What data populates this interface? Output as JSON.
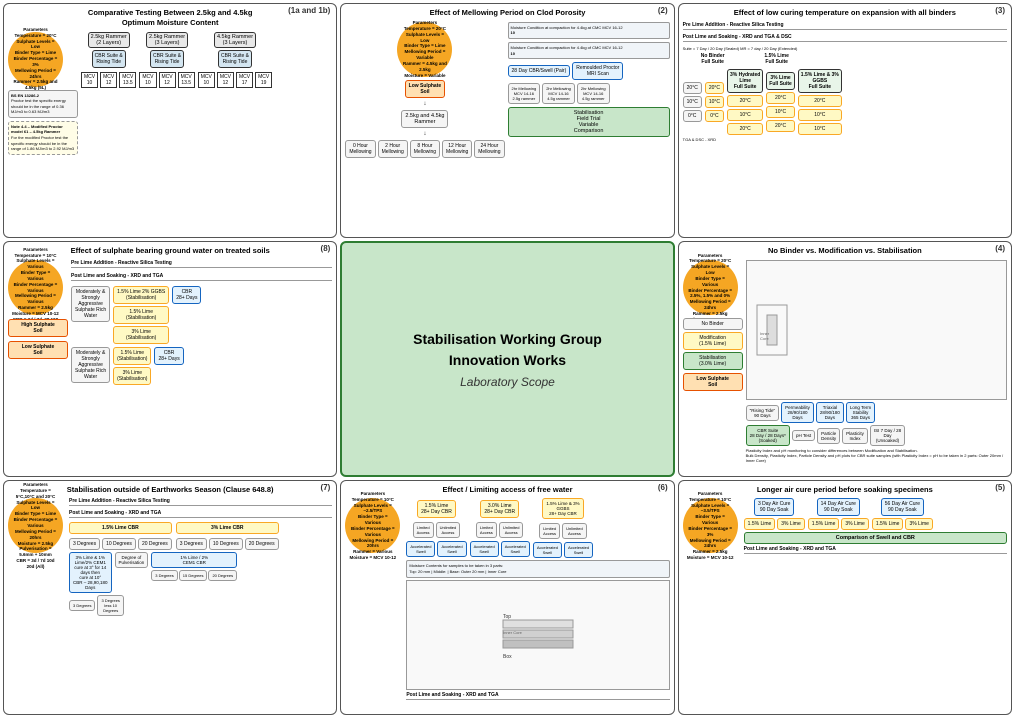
{
  "panels": {
    "panel1": {
      "number": "(1a and 1b)",
      "title": "Comparative Testing Between 2.5kg and 4.5kg",
      "subtitle": "Optimum Moisture Content",
      "params": {
        "label": "Parameters",
        "temp": "Temperature = 20°C",
        "sulphate": "Sulphate Levels = Low",
        "binder": "Binder Type = Lime",
        "binder_pct": "Binder Percentage = 3%",
        "mellowing": "Mellowing Period = 24hrs",
        "rammer": "Rammer = 2.5kg and 4.5kg (5L)"
      },
      "std_box": "BS EN 13286-2",
      "rammers": [
        {
          "label": "2.5kg Rammer\n(2 Layers)"
        },
        {
          "label": "2.5kg Rammer\n(3 Layers)"
        },
        {
          "label": "4.5kg Rammer\n(3 Layers)"
        }
      ],
      "cbr": "CBR Suite &\nRising Tide",
      "mcv_values": [
        "MCV\n10",
        "MCV\n12",
        "MCV\n13.5",
        "MCV\n10",
        "MCV\n12",
        "MCV\n13.5",
        "MCV\n10",
        "MCV\n12",
        "MCV\n17",
        "MCV\n19"
      ]
    },
    "panel2": {
      "number": "(2)",
      "title": "Effect of Mellowing Period on Clod Porosity",
      "params": {
        "label": "Parameters",
        "temp": "Temperature = 20°C",
        "sulphate": "Sulphate Levels = Low",
        "binder": "Binder Type = Lime",
        "mellowing": "Mellowing Period = Variable",
        "rammer": "Rammer = 4.5kg and 2.5kg",
        "moisture": "Moisture = Variable"
      },
      "soil_label": "Low Sulphate\nSoil",
      "rammer_label": "2.5kg and 4.5kg\nRammer",
      "mellowing_periods": [
        "0 Hour\nMellowing",
        "2 Hour\nMellowing",
        "8 Hour\nMellowing",
        "12 Hour\nMellowing",
        "24 Hour\nMellowing"
      ],
      "cbr_label": "28 Day CBR/Swell (Pair)",
      "mri_label": "Remoulded Proctor\nMRI Scan",
      "comparison": "Stabilisation\nField Trial\nVariable\nComparison",
      "sub_labels": [
        "2hr Mellowing\nMCV 14-16\n2.5g rammer",
        "2hr Mellowing\nMCV 14-16\n4.5g rammer",
        "2hr Mellowing\nMCV 14-16\n4.5g rammer"
      ],
      "moisture_note": "Moisture Condition at compaction\nfor 4.4kg at CMC MCV 16-12\n10",
      "moisture_note2": "Moisture Condition at compaction\nfor 4.4kg of CMC MCV 16-12\n10"
    },
    "panel3": {
      "number": "(3)",
      "title": "Effect of low curing temperature on expansion with all binders",
      "cols": [
        {
          "temps": [
            "20°C",
            "10°C",
            "0°C"
          ],
          "header": "No Binder\nFull Suite"
        },
        {
          "temps": [
            "20°C",
            "10°C",
            "0°C"
          ],
          "header": "1.5% Lime\nFull Suite"
        }
      ],
      "pre_lime_label": "Pre Lime Addition - Reactive Silica Testing",
      "post_lime_label": "Post Lime and Soaking - XRD and TGA & DSC",
      "suite_label": "Suite = 7 Day / 20 Day (Sealed)\nMR = 7 day / 20 Day (Extended)",
      "tga_label": "TGA & DSC - XRD",
      "binders": [
        {
          "label": "3% Hydrated\nLime\nFull Suite",
          "temps": [
            "20°C",
            "10°C",
            "20°C"
          ]
        },
        {
          "label": "3% Lime\nFull Suite",
          "temps": [
            "20°C",
            "10°C",
            "20°C"
          ]
        },
        {
          "label": "1.5% Lime & 3%\nGGBS\nFull Suite",
          "temps": [
            "20°C",
            "10°C",
            "10°C"
          ]
        }
      ]
    },
    "panel4": {
      "number": "(4)",
      "title": "No Binder vs. Modification vs. Stabilisation",
      "params": {
        "label": "Parameters",
        "temp": "Temperature = 20°C",
        "sulphate": "Sulphate Levels = Low",
        "binder": "Binder Type = Various",
        "binder_pct": "Binder Percentage = 2.5%, 1.5% and 0%",
        "mellowing": "Mellowing Period = 24hrs",
        "rammer": "Rammer = 2.5kg",
        "moisture": "Moisture = MCV 10-12"
      },
      "columns": [
        {
          "label": "No Binder"
        },
        {
          "label": "Modification\n(1.5% Lime)"
        },
        {
          "label": "Stabilisation\n(3.0% Lime)"
        }
      ],
      "soil_label": "Low Sulphate\nSoil",
      "tests": [
        {
          "label": "\"Rising Tide\"\n90 Days"
        },
        {
          "label": "Permeability\n28 / 90 / 180\nDays"
        },
        {
          "label": "Triaxial\n28 / 90 / 180\nDays"
        },
        {
          "label": "Long Term\nStability\n365 Days"
        }
      ],
      "cbr_label": "CBR Suite\n28 Day / 28 Days*\n(Soaked)",
      "ph_test": "pH Test",
      "particle_density": "Particle\nDensity",
      "plasticity_index": "Plasticity\nIndex",
      "isi_label": "ISI 7 Day / 28\nDay\n(Unsoaked)"
    },
    "panel5": {
      "number": "(5)",
      "title": "Longer air cure period before soaking specimens",
      "params": {
        "label": "Parameters",
        "temp": "Temperature = 10°C",
        "sulphate": "Sulphate Levels = ~3.5/TPS",
        "binder": "Binder Type = Various",
        "binder_pct": "Binder Percentage = 3%",
        "mellowing": "Mellowing Period = 24hrs",
        "rammer": "Rammer = 2.5kg",
        "moisture": "Moisture = MCV 10-12"
      },
      "cure_periods": [
        {
          "label": "3 Day Air Cure\n90 Day Soak"
        },
        {
          "label": "14 Day Air Cure\n90 Day Soak"
        },
        {
          "label": "56 Day Air Cure\n90 Day Soak"
        }
      ],
      "binders": [
        "1.5% Lime",
        "3% Lime",
        "1.5% Lime",
        "3% Lime",
        "1.5% Lime",
        "3% Lime"
      ],
      "footer": "Comparison of Swell and CBR",
      "post_lime": "Post Lime and Soaking - XRD and TGA"
    },
    "panel6": {
      "number": "(6)",
      "title": "Effect / Limiting access of free water",
      "params": {
        "label": "Parameters",
        "temp": "Temperature = 10°C",
        "sulphate": "Sulphate Levels = ~2.5/TPS",
        "binder": "Binder Type = Various",
        "binder_pct": "Binder Percentage = Various",
        "mellowing": "Mellowing Period = 20hrs",
        "rammer": "Rammer = Various",
        "moisture": "Moisture = MCV 10-12"
      },
      "treatments": [
        {
          "label": "1.5% Lime\n28+ Day CBR"
        },
        {
          "label": "3.0% Lime\n28+ Day CBR"
        },
        {
          "label": "1.5% Lime & 3%\nGGBS\n28+ Day CBR"
        }
      ],
      "access_types": [
        "Limited\nAccess",
        "Unlimited\nAccess"
      ],
      "test_types": [
        "Accelerated\nSwell",
        "Accelerated\nSwell",
        "Accelerated\nSwell"
      ],
      "footer": "Post Lime and Soaking - XRD and TGA",
      "moisture_note": "Moisture Contents for samples to be\ntaken in 3 parts:\nTop: 20 mm\nMiddle:\nBase: Outer 20 mm\nInner Core"
    },
    "panel7": {
      "number": "(7)",
      "title": "Stabilisation outside of Earthworks Season (Clause 648.8)",
      "params": {
        "label": "Parameters",
        "temp": "Temperature = 5°C, 10°C and 20°C",
        "sulphate": "Sulphate Levels = Low",
        "binder": "Binder Type = Lime",
        "binder_pct": "Binder Percentage = Various",
        "mellowing": "Mellowing Period = 20hrs",
        "moisture": "Moisture = 2.5kg",
        "pulverisation": "Pulverisation = 5.6mm + 10mm",
        "cbr": "CBR = 3d / 7d 10d 20d (All)"
      },
      "pre_lime": "Pre Lime Addition - Reactive Silica Testing",
      "post_lime": "Post Lime and Soaking - XRD and TGA",
      "treatments": [
        {
          "label": "1.5% Lime CBR"
        },
        {
          "label": "3% Lime CBR"
        }
      ],
      "temps": [
        "3 Degrees",
        "10 Degrees",
        "20 Degrees"
      ],
      "combo_label": "3% Lime & 1%\nLime/2% CEM1\ncure at 3° for 14\ndays then\ncure at 10°\nCBR – 28,90,180\nDays",
      "pulverisation_label": "Degree of\nPulverisation",
      "combo2": "1% Lime / 2%\nCEM1 CBR",
      "final_temps": [
        "3 Degrees",
        "15 Degrees",
        "20 Degrees"
      ],
      "final_temps2": [
        "3 Degrees",
        "Less than 10\nDegrees",
        ""
      ],
      "deg3": "3 Degrees",
      "deg10": "3 Degrees\nless 10\nDegrees"
    },
    "panel8": {
      "number": "(8)",
      "title": "Effect of sulphate bearing ground water on treated soils",
      "params": {
        "label": "Parameters",
        "temp": "Temperature = 10°C",
        "sulphate": "Sulphate Levels = Various",
        "binder": "Binder Type = Various",
        "binder_pct": "Binder Percentage = Various",
        "mellowing": "Mellowing Period = Various",
        "rammer": "Rammer = 2.5kg",
        "moisture": "Moisture = MCV 10-12\nCBR = 3d / 7d, 28,100 (All)"
      },
      "high_sulphate": "High Sulphate\nSoil",
      "low_sulphate": "Low Sulphate\nSoil",
      "aggressive_label": "Moderately &\nStrongly\nAggressive\nSulphate Rich\nWater",
      "treatments_high": [
        "1.5% Lime 2% GGBS\n(Stabilisation)",
        "1.5% Lime\n(Stabilisation)",
        "3% Lime\n(Stabilisation)"
      ],
      "treatments_low": [
        "1.5% Lime\n(Stabilisation)",
        "3% Lime\n(Stabilisation)"
      ],
      "cbr_label": "CBR\n28+ Days",
      "pre_lime": "Pre Lime Addition - Reactive Silica Testing",
      "post_lime": "Post Lime and Soaking - XRD and TGA"
    },
    "center": {
      "line1": "Stabilisation Working Group",
      "line2": "Innovation Works",
      "line3": "Laboratory Scope"
    }
  }
}
